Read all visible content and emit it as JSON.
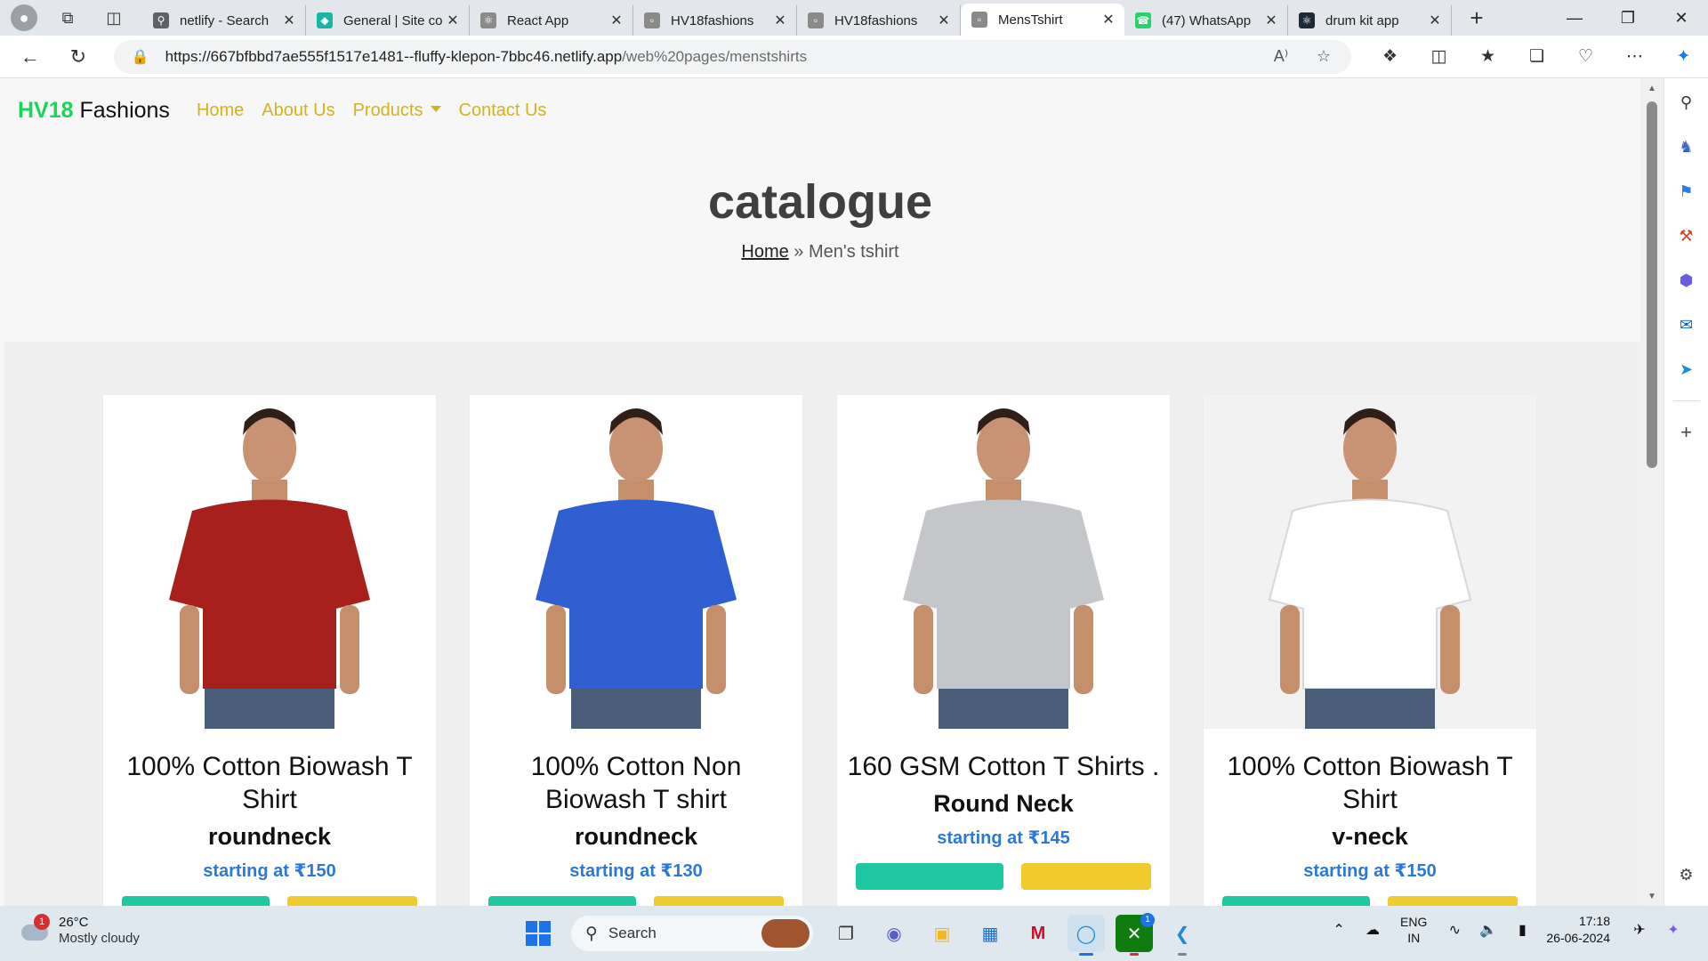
{
  "browser": {
    "tabs": [
      {
        "title": "netlify - Search",
        "icon": "search-icon",
        "color": "#5f6368",
        "active": false
      },
      {
        "title": "General | Site co",
        "icon": "netlify-icon",
        "color": "#15b8a6",
        "active": false
      },
      {
        "title": "React App",
        "icon": "react-icon",
        "color": "#8a8a8a",
        "active": false
      },
      {
        "title": "HV18fashions",
        "icon": "page-icon",
        "color": "#8a8a8a",
        "active": false
      },
      {
        "title": "HV18fashions",
        "icon": "page-icon",
        "color": "#8a8a8a",
        "active": false
      },
      {
        "title": "MensTshirt",
        "icon": "page-icon",
        "color": "#8a8a8a",
        "active": true
      },
      {
        "title": "(47) WhatsApp",
        "icon": "whatsapp-icon",
        "color": "#25d366",
        "active": false
      },
      {
        "title": "drum kit app",
        "icon": "react-icon",
        "color": "#1d2a3a",
        "active": false
      }
    ],
    "url_main": "https://667bfbbd7ae555f1517e1481--fluffy-klepon-7bbc46.netlify.app",
    "url_path": "/web%20pages/menstshirts"
  },
  "site": {
    "brand_accent": "HV18",
    "brand_rest": " Fashions",
    "nav": {
      "home": "Home",
      "about": "About Us",
      "products": "Products",
      "contact": "Contact Us"
    },
    "hero_title": "catalogue",
    "breadcrumb_home": "Home",
    "breadcrumb_sep": " » ",
    "breadcrumb_current": "Men's tshirt",
    "products": [
      {
        "title": "100% Cotton Biowash T Shirt",
        "neck": "roundneck",
        "price": "starting at ₹150",
        "shirt_color": "#a8201c"
      },
      {
        "title": "100% Cotton Non Biowash T shirt",
        "neck": "roundneck",
        "price": "starting at ₹130",
        "shirt_color": "#2f5fd0"
      },
      {
        "title": "160 GSM Cotton T Shirts .",
        "neck": "Round Neck",
        "price": "starting at ₹145",
        "shirt_color": "#c4c6c9"
      },
      {
        "title": "100% Cotton Biowash T Shirt",
        "neck": "v-neck",
        "price": "starting at ₹150",
        "shirt_color": "#ffffff"
      }
    ]
  },
  "colors": {
    "brand_green": "#17d65a",
    "nav_gold": "#d4b21d",
    "price_blue": "#2d78d6"
  },
  "taskbar": {
    "temperature": "26°C",
    "condition": "Mostly cloudy",
    "weather_badge": "1",
    "search_placeholder": "Search",
    "lang_top": "ENG",
    "lang_bottom": "IN",
    "time": "17:18",
    "date": "26-06-2024",
    "xbox_badge": "1"
  }
}
